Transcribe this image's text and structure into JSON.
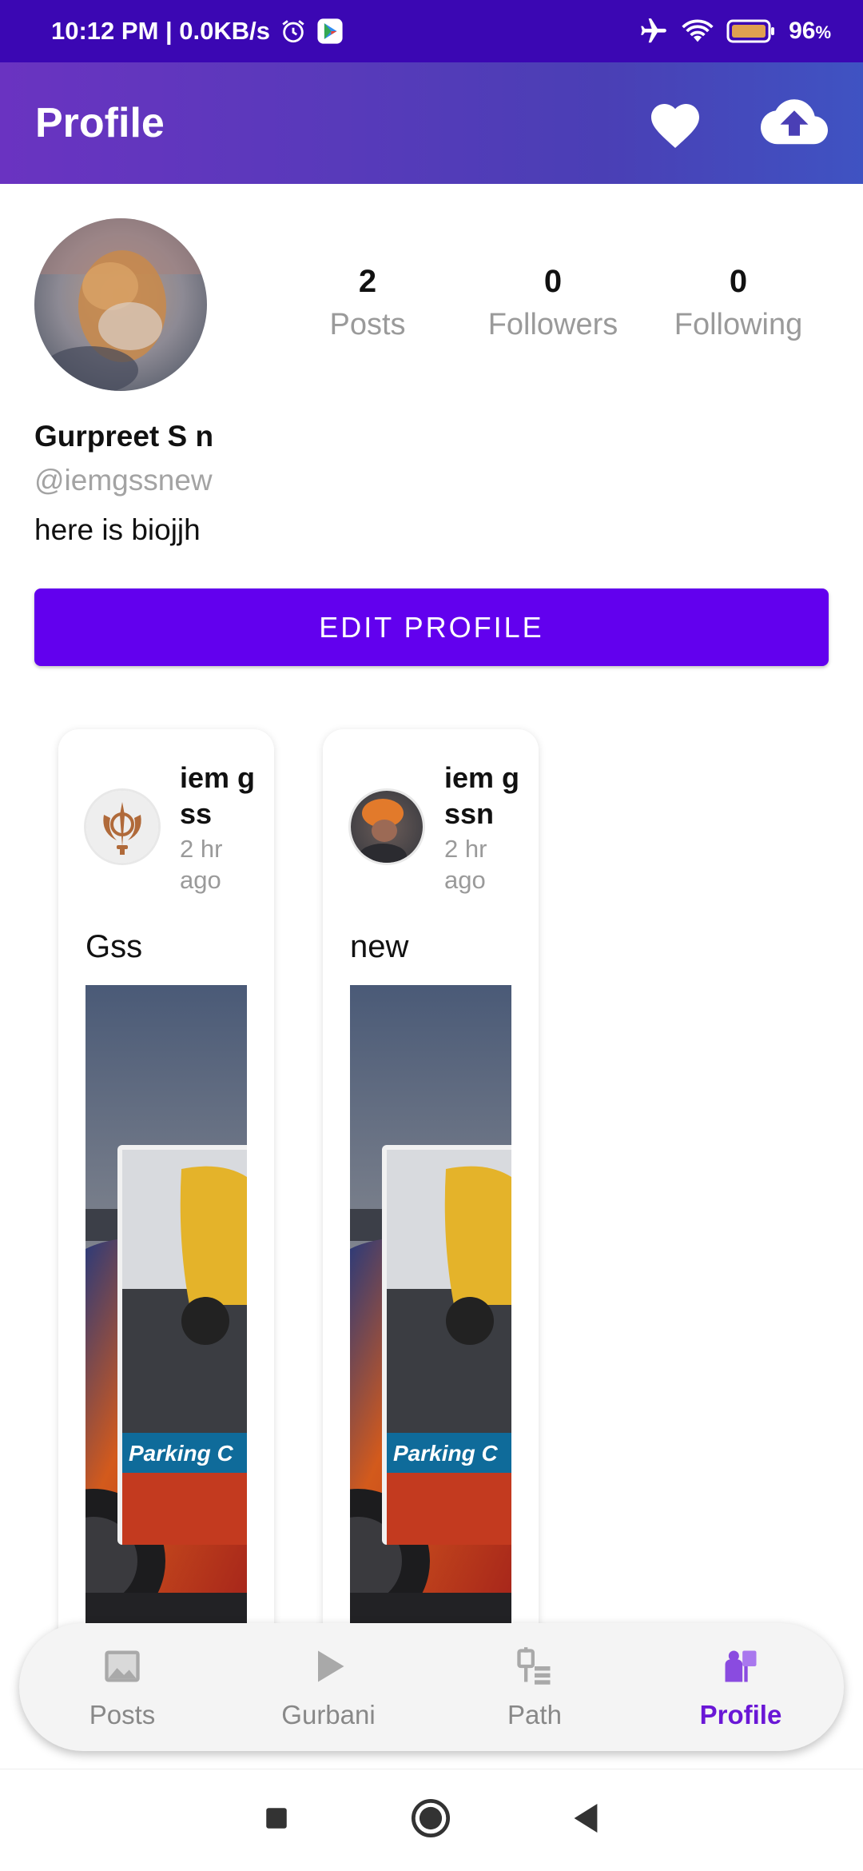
{
  "status_bar": {
    "time": "10:12 PM | 0.0KB/s",
    "battery": "96",
    "battery_unit": "%",
    "icons": [
      "alarm-icon",
      "play-store-icon",
      "airplane-icon",
      "wifi-icon",
      "battery-icon"
    ]
  },
  "header": {
    "title": "Profile",
    "actions": [
      "heart-icon",
      "cloud-upload-icon"
    ]
  },
  "profile": {
    "name": "Gurpreet S n",
    "handle": "@iemgssnew",
    "bio": "here is biojjh",
    "stats": [
      {
        "value": "2",
        "label": "Posts"
      },
      {
        "value": "0",
        "label": "Followers"
      },
      {
        "value": "0",
        "label": "Following"
      }
    ],
    "edit_button": "EDIT PROFILE"
  },
  "posts": [
    {
      "user": "iem gss",
      "time": "2 hr ago",
      "text": "Gss",
      "image_caption": "Parking C"
    },
    {
      "user": "iem gssn",
      "time": "2 hr ago",
      "text": "new",
      "image_caption": "Parking C"
    }
  ],
  "bottom_nav": {
    "items": [
      {
        "label": "Posts",
        "icon": "image-icon"
      },
      {
        "label": "Gurbani",
        "icon": "play-icon"
      },
      {
        "label": "Path",
        "icon": "path-icon"
      },
      {
        "label": "Profile",
        "icon": "profile-icon"
      }
    ],
    "active_index": 3
  },
  "colors": {
    "status_bar": "#3b07b3",
    "primary": "#6200ee",
    "active_nav": "#6a17d6"
  }
}
